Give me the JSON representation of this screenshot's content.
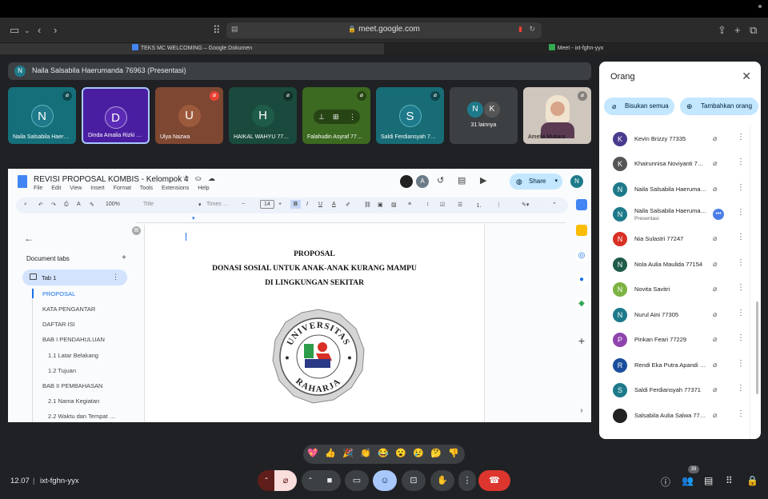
{
  "browser": {
    "url": "meet.google.com",
    "tabs": [
      {
        "label": "TEKS MC WELCOMING – Google Dokumen",
        "active": true
      },
      {
        "label": "Meet - ixt-fghn-yyx",
        "active": false
      }
    ]
  },
  "banner": {
    "avatar_letter": "N",
    "text": "Naila Salsabila Haerumanda 76963 (Presentasi)"
  },
  "tiles": [
    {
      "letter": "N",
      "name": "Naila Salsabila Haer…",
      "color": "#1e7a8a",
      "bg": "#156f7a"
    },
    {
      "letter": "D",
      "name": "Dinda Amalia Rizki …",
      "color": "#5b2bb5",
      "bg": "#4a1ea1"
    },
    {
      "letter": "U",
      "name": "Ulya Nazwa",
      "color": "#9c5a3c",
      "bg": "#7e4731"
    },
    {
      "letter": "H",
      "name": "HAIKAL WAHYU 77…",
      "color": "#1f5b49",
      "bg": "#1a4a3d"
    },
    {
      "letter": "",
      "name": "Falahudin Asyraf 77…",
      "color": "#3d6b1f",
      "bg": "#3c6a20"
    },
    {
      "letter": "S",
      "name": "Saldi Ferdiansyah 7…",
      "color": "#1e7a8a",
      "bg": "#176c76"
    },
    {
      "letter": "",
      "name": "31 lainnya",
      "color": "#3c4043",
      "bg": "#3c4043",
      "group": [
        "N",
        "K"
      ]
    },
    {
      "letter": "",
      "name": "Amelia Mutiara",
      "color": "#cfc6bd",
      "bg": "#cfc6bd"
    }
  ],
  "doc": {
    "title": "REVISI PROPOSAL KOMBIS - Kelompok 4",
    "menu": [
      "File",
      "Edit",
      "View",
      "Insert",
      "Format",
      "Tools",
      "Extensions",
      "Help"
    ],
    "share_label": "Share",
    "user_letter": "N",
    "toolbar": {
      "zoom": "100%",
      "style": "Title",
      "font": "Times …",
      "size": "14"
    },
    "sidebar": {
      "header": "Document tabs",
      "tab_label": "Tab 1",
      "outline": [
        {
          "text": "PROPOSAL",
          "indent": 1,
          "active": true
        },
        {
          "text": "KATA PENGANTAR",
          "indent": 1
        },
        {
          "text": "DAFTAR ISI",
          "indent": 1
        },
        {
          "text": "BAB I PENDAHULUAN",
          "indent": 1
        },
        {
          "text": "1.1 Latar Belakang",
          "indent": 2
        },
        {
          "text": "1.2 Tujuan",
          "indent": 2
        },
        {
          "text": "BAB II PEMBAHASAN",
          "indent": 1
        },
        {
          "text": "2.1 Nama Kegiatan",
          "indent": 2
        },
        {
          "text": "2.2 Waktu dan Tempat …",
          "indent": 2
        }
      ]
    },
    "page": {
      "heading1": "PROPOSAL",
      "heading2": "DONASI SOSIAL UNTUK ANAK-ANAK KURANG MAMPU",
      "heading3": "DI LINGKUNGAN SEKITAR",
      "logo_top": "UNIVERSITAS",
      "logo_bottom": "RAHARJA"
    }
  },
  "panel": {
    "title": "Orang",
    "mute_all": "Bisukan semua",
    "add_people": "Tambahkan orang",
    "participants": [
      {
        "letter": "K",
        "name": "Kevin Brizzy 77335",
        "color": "#4a3b8f"
      },
      {
        "letter": "K",
        "name": "Khairunnisa Noviyanti 7…",
        "color": "#555"
      },
      {
        "letter": "N",
        "name": "Naila Salsabila Haeruma…",
        "color": "#1e7a8a"
      },
      {
        "letter": "N",
        "name": "Naila Salsabila Haeruma…",
        "sub": "Presentasi",
        "color": "#1e7a8a",
        "presenting": true
      },
      {
        "letter": "N",
        "name": "Nia Sulastri 77247",
        "color": "#d93025"
      },
      {
        "letter": "N",
        "name": "Nola Aulia Maulida 77154",
        "color": "#1f5b49"
      },
      {
        "letter": "N",
        "name": "Novita Savitri",
        "color": "#7cb342"
      },
      {
        "letter": "N",
        "name": "Nurul Aini 77305",
        "color": "#1e7a8a"
      },
      {
        "letter": "P",
        "name": "Pinkan Feari 77229",
        "color": "#8e44ad"
      },
      {
        "letter": "R",
        "name": "Rendi Eka Putra Apandi …",
        "color": "#1a4e9c"
      },
      {
        "letter": "S",
        "name": "Saldi Ferdiansyah 77371",
        "color": "#1e7a8a"
      },
      {
        "letter": "",
        "name": "Salsabila Aulia Salwa 77…",
        "color": "#222"
      }
    ]
  },
  "reactions": [
    "💖",
    "👍",
    "🎉",
    "👏",
    "😂",
    "😮",
    "😢",
    "🤔",
    "👎"
  ],
  "bottom": {
    "time": "12.07",
    "separator": "|",
    "meeting_code": "ixt-fghn-yyx",
    "people_count": "39"
  }
}
